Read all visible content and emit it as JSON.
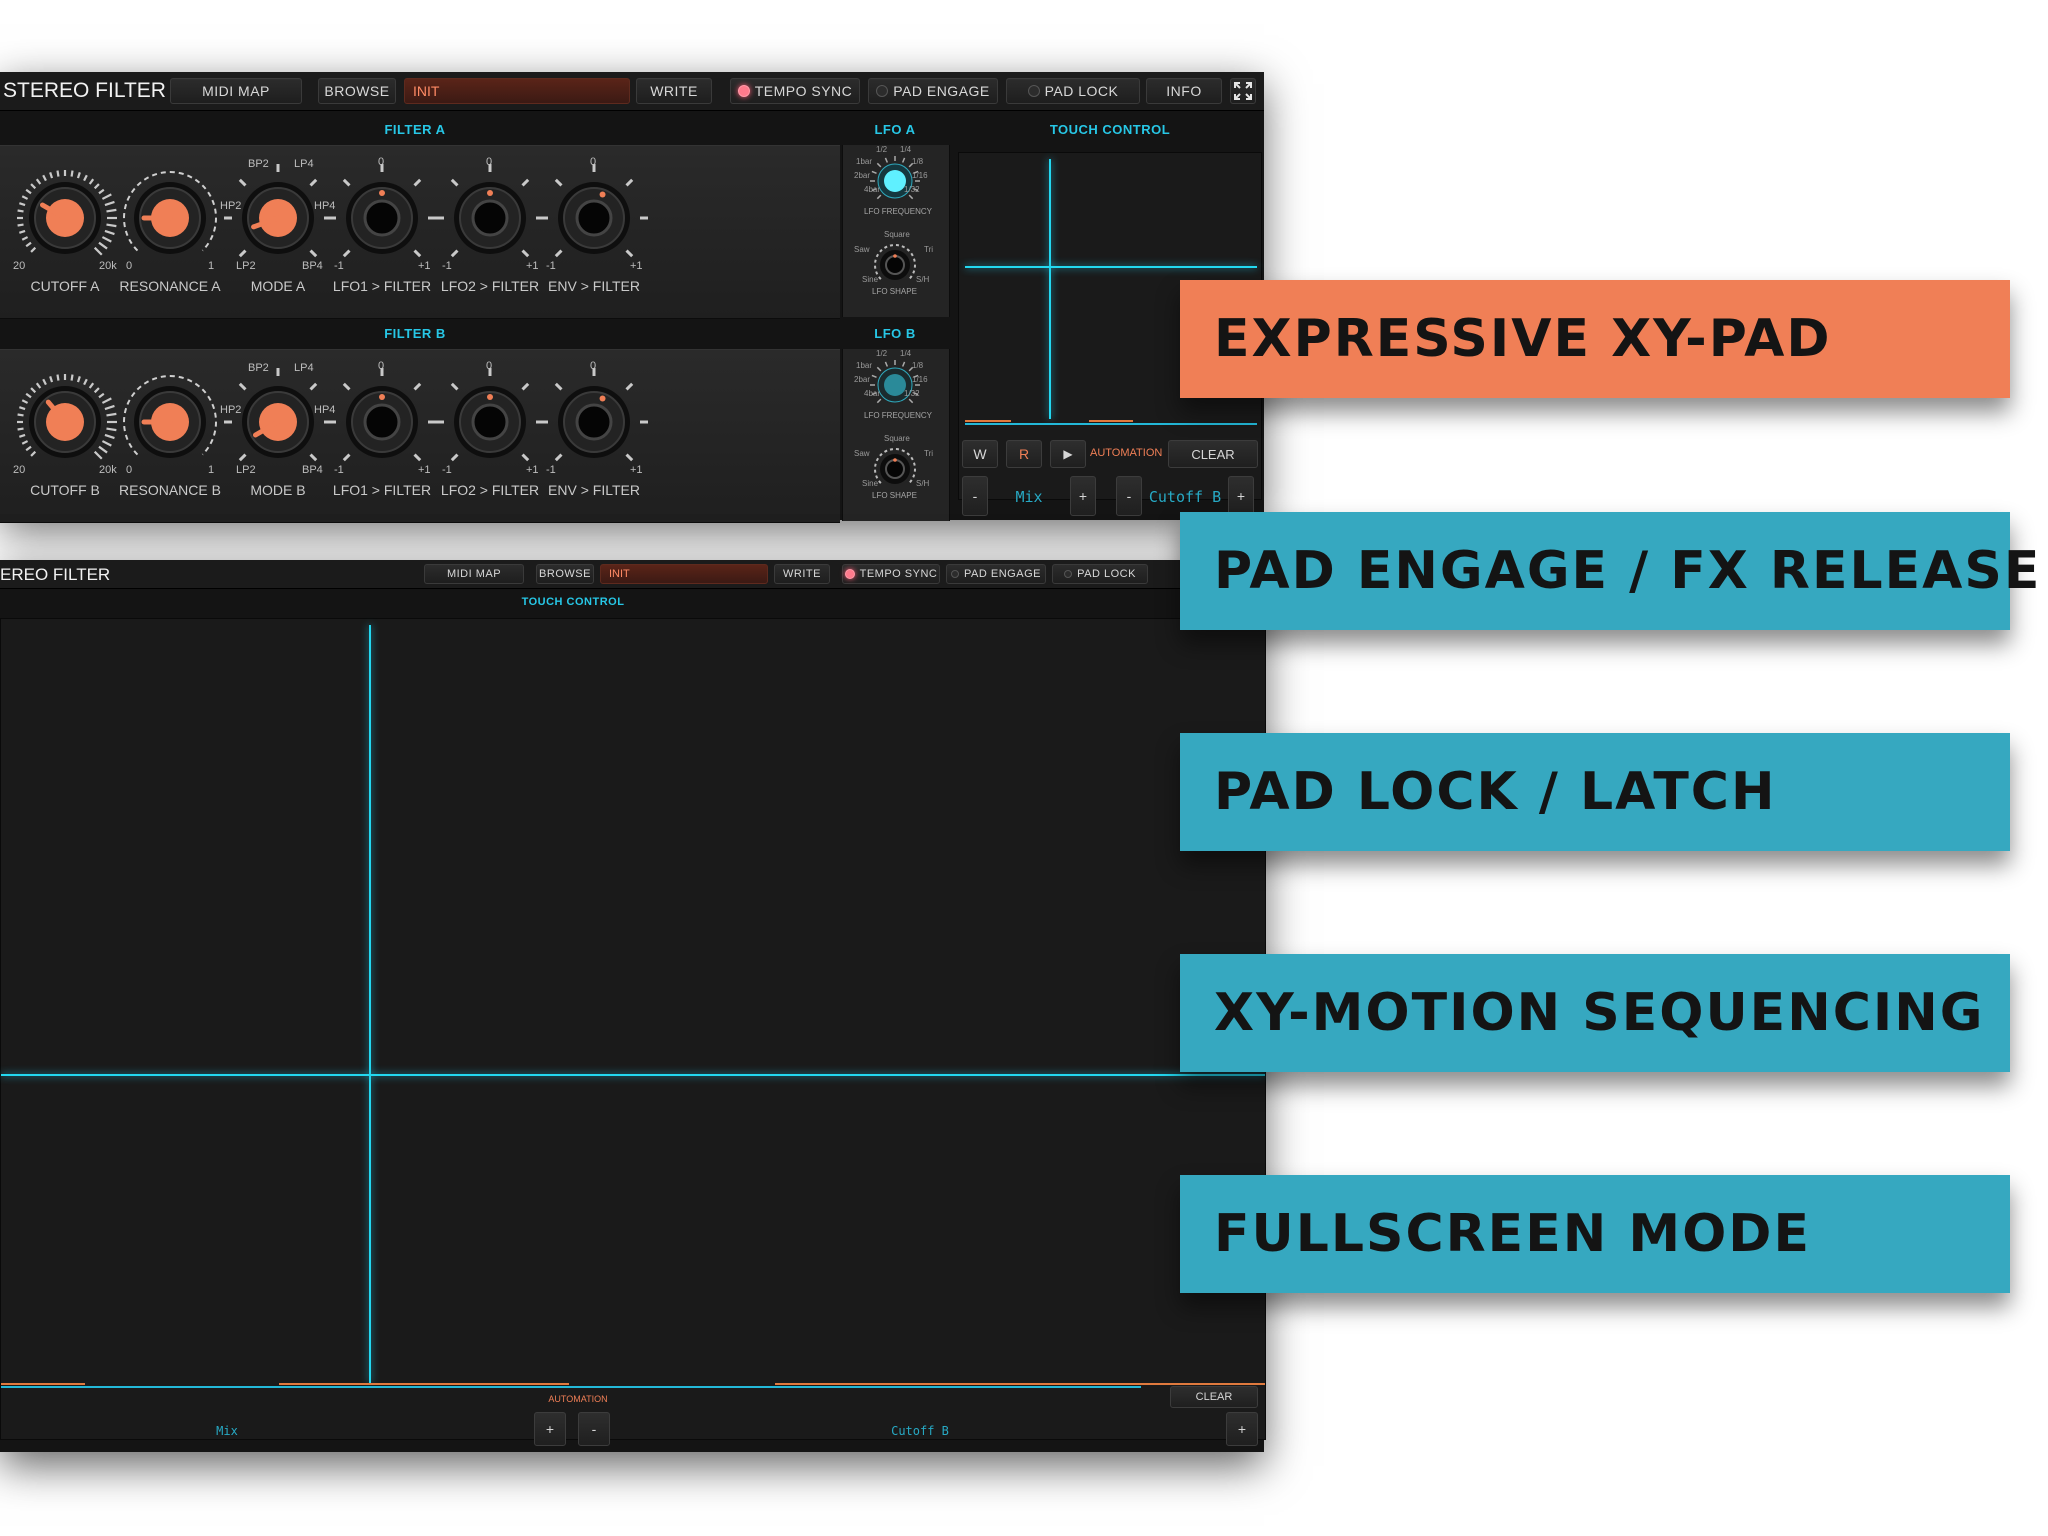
{
  "top": {
    "title": "STEREO FILTER",
    "buttons": {
      "midi_map": "MIDI MAP",
      "browse": "BROWSE",
      "preset": "INIT",
      "write": "WRITE",
      "tempo_sync": "TEMPO SYNC",
      "pad_engage": "PAD ENGAGE",
      "pad_lock": "PAD LOCK",
      "info": "INFO"
    },
    "filter_a": {
      "head": "FILTER A",
      "knobs": [
        "CUTOFF A",
        "RESONANCE A",
        "MODE A",
        "LFO1 > FILTER",
        "LFO2 > FILTER",
        "ENV > FILTER"
      ]
    },
    "filter_b": {
      "head": "FILTER B",
      "knobs": [
        "CUTOFF B",
        "RESONANCE B",
        "MODE B",
        "LFO1 > FILTER",
        "LFO2 > FILTER",
        "ENV > FILTER"
      ]
    },
    "scales": {
      "cutoff_min": "20",
      "cutoff_max": "20k",
      "res_min": "0",
      "res_max": "1",
      "mode_bp2": "BP2",
      "mode_lp4": "LP4",
      "mode_hp2": "HP2",
      "mode_hp4": "HP4",
      "mode_lp2": "LP2",
      "mode_bp4": "BP4",
      "bip_min": "-1",
      "bip_mid": "0",
      "bip_max": "+1"
    },
    "lfo_a": {
      "head": "LFO A",
      "freq": "LFO FREQUENCY",
      "shape": "LFO SHAPE"
    },
    "lfo_b": {
      "head": "LFO B",
      "freq": "LFO FREQUENCY",
      "shape": "LFO SHAPE"
    },
    "lfo_marks": {
      "d12": "1/2",
      "d14": "1/4",
      "b1": "1bar",
      "d18": "1/8",
      "b2": "2bar",
      "d116": "1/16",
      "b4": "4bar",
      "d132": "1/32",
      "square": "Square",
      "saw": "Saw",
      "tri": "Tri",
      "sine": "Sine",
      "sh": "S/H"
    },
    "touch": {
      "head": "TOUCH CONTROL",
      "w": "W",
      "r": "R",
      "play": "▶",
      "automation": "AUTOMATION",
      "clear": "CLEAR",
      "minus": "-",
      "plus": "+",
      "x_param": "Mix",
      "y_param": "Cutoff B"
    }
  },
  "full": {
    "title": "EREO FILTER",
    "buttons": {
      "midi_map": "MIDI MAP",
      "browse": "BROWSE",
      "preset": "INIT",
      "write": "WRITE",
      "tempo_sync": "TEMPO SYNC",
      "pad_engage": "PAD ENGAGE",
      "pad_lock": "PAD LOCK"
    },
    "touch_head": "TOUCH CONTROL",
    "automation": "AUTOMATION",
    "clear": "CLEAR",
    "plus": "+",
    "minus": "-",
    "x_param": "Mix",
    "y_param": "Cutoff B"
  },
  "callouts": [
    {
      "text": "EXPRESSIVE XY-PAD",
      "color": "#f07f56"
    },
    {
      "text": "PAD ENGAGE / FX RELEASE",
      "color": "#36a8c0"
    },
    {
      "text": "PAD LOCK / LATCH",
      "color": "#36a8c0"
    },
    {
      "text": "XY-MOTION SEQUENCING",
      "color": "#36a8c0"
    },
    {
      "text": "FULLSCREEN MODE",
      "color": "#36a8c0"
    }
  ],
  "colors": {
    "accent_orange": "#f07f56",
    "accent_cyan": "#23d8f0"
  },
  "icons": {
    "fullscreen": "expand-icon"
  }
}
